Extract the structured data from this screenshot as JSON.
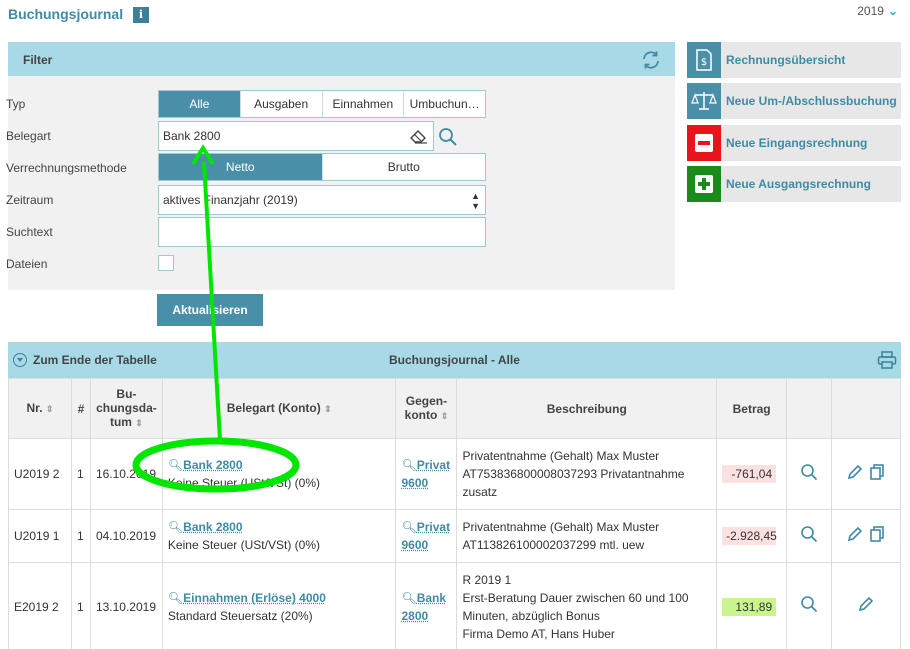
{
  "header": {
    "title": "Buchungsjournal",
    "info_icon": "i",
    "year": "2019"
  },
  "filter": {
    "title": "Filter",
    "labels": {
      "typ": "Typ",
      "belegart": "Belegart",
      "methode": "Verrechnungsmethode",
      "zeitraum": "Zeitraum",
      "suchtext": "Suchtext",
      "dateien": "Dateien"
    },
    "typ_options": [
      "Alle",
      "Ausgaben",
      "Einnahmen",
      "Umbuchun…"
    ],
    "typ_selected": "Alle",
    "belegart_value": "Bank 2800",
    "methode_options": [
      "Netto",
      "Brutto"
    ],
    "methode_selected": "Netto",
    "zeitraum_value": "aktives Finanzjahr (2019)",
    "suchtext_value": "",
    "refresh_label": "Aktualisieren"
  },
  "side_buttons": [
    {
      "label": "Rechnungsübersicht",
      "icon": "invoice-icon",
      "color": "#4a8fa8"
    },
    {
      "label": "Neue Um-/Abschlussbuchung",
      "icon": "balance-scale-icon",
      "color": "#4a8fa8"
    },
    {
      "label": "Neue Eingangsrechnung",
      "icon": "minus-icon",
      "color": "#e8141c"
    },
    {
      "label": "Neue Ausgangsrechnung",
      "icon": "plus-icon",
      "color": "#1a8a1a"
    }
  ],
  "table_bar": {
    "jump_label": "Zum Ende der Tabelle",
    "title": "Buchungsjournal - Alle"
  },
  "columns": [
    "Nr.",
    "#",
    "Buchungsdatum",
    "Belegart (Konto)",
    "Gegenkonto",
    "Beschreibung",
    "Betrag"
  ],
  "column_display": {
    "nr": "Nr.",
    "hash": "#",
    "datum_l1": "Bu-",
    "datum_l2": "chungsda-",
    "datum_l3": "tum",
    "belegart": "Belegart (Konto)",
    "gegen_l1": "Gegen-",
    "gegen_l2": "konto",
    "beschreibung": "Beschreibung",
    "betrag": "Betrag"
  },
  "rows": [
    {
      "nr": "U2019 2",
      "num": "1",
      "date": "16.10.2019",
      "belegart": "Bank 2800",
      "tax": "Keine Steuer (USt/VSt) (0%)",
      "gegen_a": "Privat",
      "gegen_b": "9600",
      "desc1": "Privatentnahme (Gehalt) Max Muster",
      "desc2": "AT753836800008037293 Privatantnahme",
      "desc3": "zusatz",
      "desc4": "",
      "amount": "-761,04"
    },
    {
      "nr": "U2019 1",
      "num": "1",
      "date": "04.10.2019",
      "belegart": "Bank 2800",
      "tax": "Keine Steuer (USt/VSt) (0%)",
      "gegen_a": "Privat",
      "gegen_b": "9600",
      "desc1": "Privatentnahme (Gehalt) Max Muster",
      "desc2": "AT113826100002037299 mtl. uew",
      "desc3": "",
      "desc4": "",
      "amount": "-2.928,45"
    },
    {
      "nr": "E2019 2",
      "num": "1",
      "date": "13.10.2019",
      "belegart": "Einnahmen (Erlöse) 4000",
      "tax": "Standard Steuersatz (20%)",
      "gegen_a": "Bank",
      "gegen_b": "2800",
      "desc1": "R 2019 1",
      "desc2": "Erst-Beratung Dauer zwischen 60 und 100",
      "desc3": "Minuten, abzüglich Bonus",
      "desc4": "Firma Demo AT, Hans Huber",
      "amount": "131,89"
    }
  ],
  "colors": {
    "accent": "#4a8fa8",
    "header_bg": "#a8d9e6",
    "annotation": "#00e600",
    "negative_bg": "#fde0e0",
    "positive_bg": "#c9f58f"
  }
}
